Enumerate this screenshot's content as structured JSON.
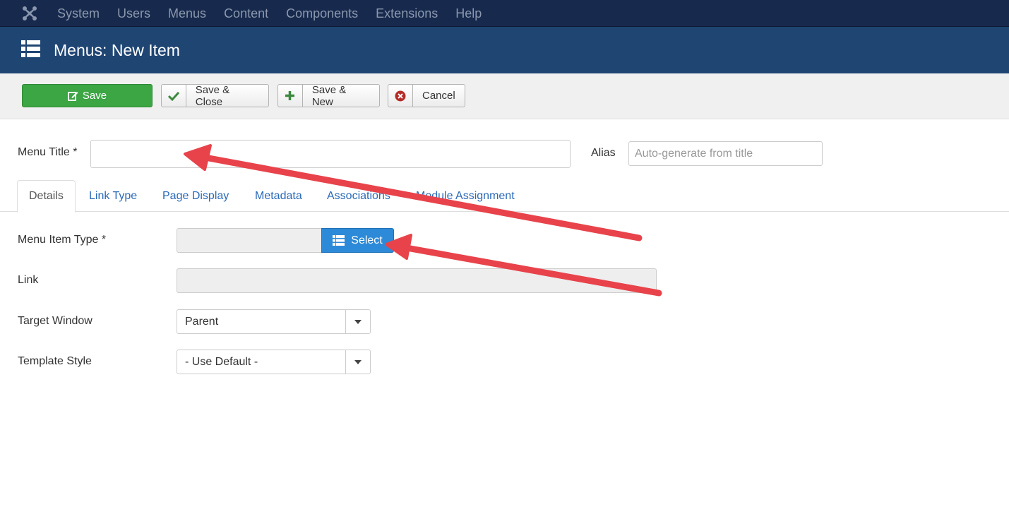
{
  "navbar": {
    "logo_icon": "joomla-logo-icon",
    "items": [
      "System",
      "Users",
      "Menus",
      "Content",
      "Components",
      "Extensions",
      "Help"
    ]
  },
  "header": {
    "icon": "list-icon",
    "title": "Menus: New Item"
  },
  "toolbar": {
    "save_label": "Save",
    "save_close_label": "Save & Close",
    "save_new_label": "Save & New",
    "cancel_label": "Cancel"
  },
  "form": {
    "menu_title_label": "Menu Title *",
    "menu_title_value": "",
    "alias_label": "Alias",
    "alias_placeholder": "Auto-generate from title",
    "menu_item_type_label": "Menu Item Type *",
    "select_label": "Select",
    "link_label": "Link",
    "target_window_label": "Target Window",
    "target_window_value": "Parent",
    "template_style_label": "Template Style",
    "template_style_value": "- Use Default -"
  },
  "tabs": [
    "Details",
    "Link Type",
    "Page Display",
    "Metadata",
    "Associations",
    "Module Assignment"
  ],
  "colors": {
    "navbar": "#172a4d",
    "header": "#1f4573",
    "save_green": "#3ca544",
    "select_blue": "#2d8ad8",
    "annotation_arrow": "#e8434b"
  }
}
